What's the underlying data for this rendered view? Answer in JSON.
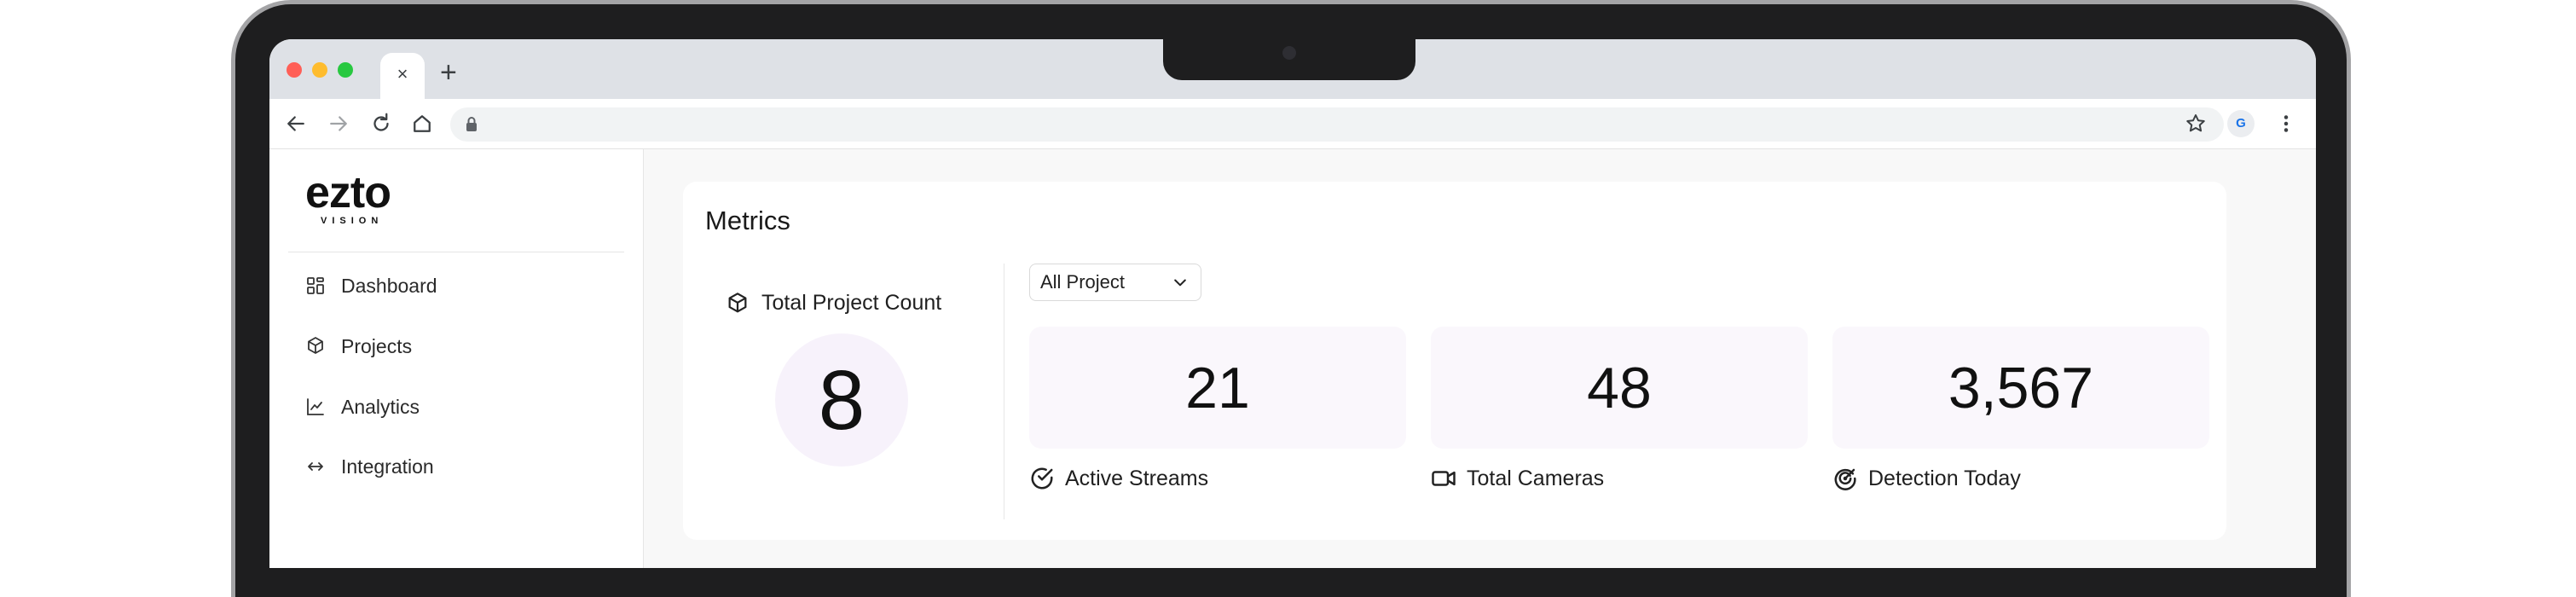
{
  "browser": {
    "traffic_lights": [
      "#ff5f57",
      "#febc2e",
      "#28c840"
    ],
    "tab_close_label": "×",
    "new_tab_label": "+",
    "address_value": "",
    "profile_initial": "G"
  },
  "app": {
    "logo": {
      "main": "ezto",
      "sub": "VISION"
    },
    "nav": [
      {
        "label": "Dashboard",
        "icon": "dashboard-icon"
      },
      {
        "label": "Projects",
        "icon": "cube-icon"
      },
      {
        "label": "Analytics",
        "icon": "chart-icon"
      },
      {
        "label": "Integration",
        "icon": "arrows-horizontal-icon"
      }
    ],
    "metrics": {
      "title": "Metrics",
      "total_project_count_label": "Total Project Count",
      "total_project_count_value": "8",
      "filter_value": "All Project",
      "stats": [
        {
          "value": "21",
          "label": "Active Streams",
          "icon": "check-circle-icon"
        },
        {
          "value": "48",
          "label": "Total Cameras",
          "icon": "video-camera-icon"
        },
        {
          "value": "3,567",
          "label": "Detection Today",
          "icon": "radar-icon"
        }
      ]
    }
  }
}
